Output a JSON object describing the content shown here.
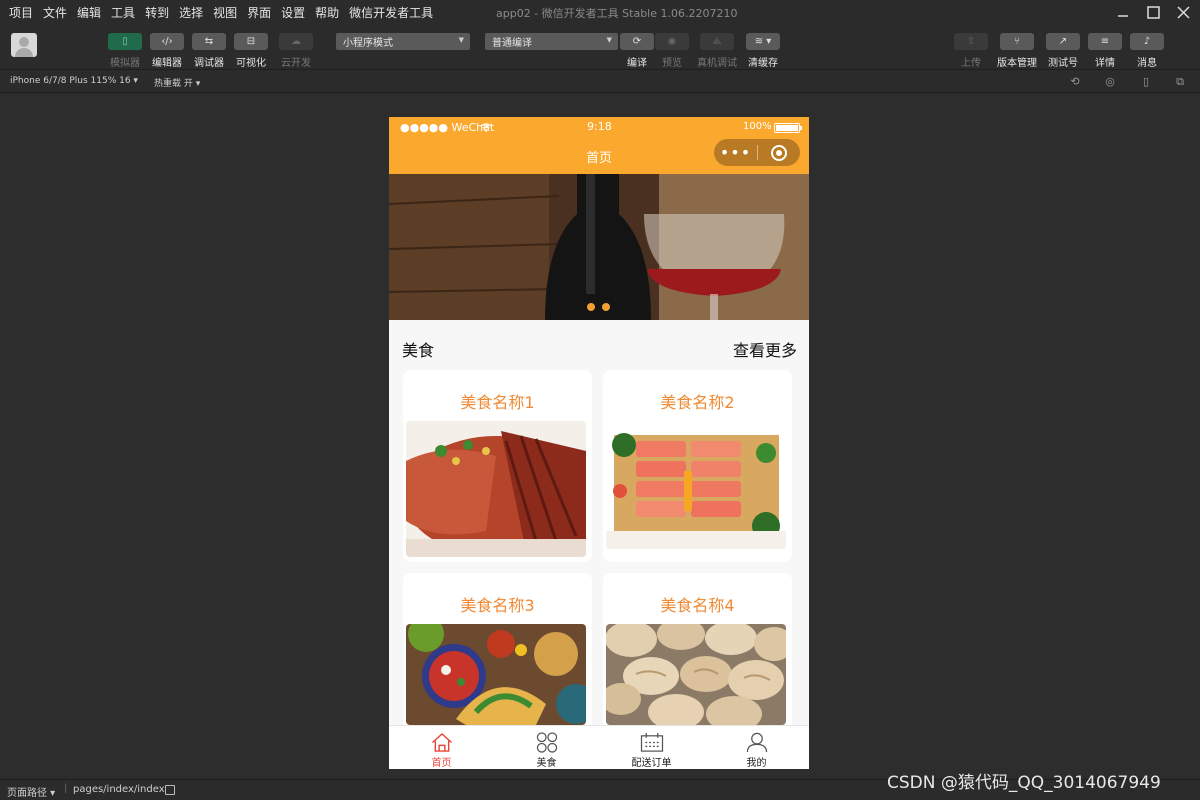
{
  "menubar": {
    "items": [
      "项目",
      "文件",
      "编辑",
      "工具",
      "转到",
      "选择",
      "视图",
      "界面",
      "设置",
      "帮助",
      "微信开发者工具"
    ],
    "window_title": "app02 - 微信开发者工具 Stable 1.06.2207210"
  },
  "toolbar": {
    "left_buttons": [
      {
        "label": "模拟器",
        "icon": "phone-icon",
        "state": "active"
      },
      {
        "label": "编辑器",
        "icon": "code-icon",
        "state": "normal"
      },
      {
        "label": "调试器",
        "icon": "debug-icon",
        "state": "normal"
      },
      {
        "label": "可视化",
        "icon": "layout-icon",
        "state": "normal"
      },
      {
        "label": "云开发",
        "icon": "cloud-icon",
        "state": "disabled"
      }
    ],
    "mode_select": "小程序模式",
    "compile_select": "普通编译",
    "center_buttons": [
      {
        "label": "编译",
        "icon": "refresh-icon",
        "state": "normal"
      },
      {
        "label": "预览",
        "icon": "eye-icon",
        "state": "disabled"
      },
      {
        "label": "真机调试",
        "icon": "device-debug-icon",
        "state": "disabled"
      },
      {
        "label": "清缓存",
        "icon": "layers-icon",
        "state": "normal"
      }
    ],
    "right_buttons": [
      {
        "label": "上传",
        "icon": "upload-icon",
        "state": "disabled"
      },
      {
        "label": "版本管理",
        "icon": "branch-icon",
        "state": "normal"
      },
      {
        "label": "测试号",
        "icon": "external-link-icon",
        "state": "normal"
      },
      {
        "label": "详情",
        "icon": "menu-icon",
        "state": "normal"
      },
      {
        "label": "消息",
        "icon": "bell-icon",
        "state": "normal"
      }
    ]
  },
  "subbar": {
    "device": "iPhone 6/7/8 Plus 115% 16 ▾",
    "hot_reload": "热重载 开 ▾"
  },
  "phone": {
    "status": {
      "carrier": "●●●●● WeChat",
      "time": "9:18",
      "battery": "100%"
    },
    "nav_title": "首页",
    "capsule_more": "•••",
    "banner_dots": 2,
    "section_title": "美食",
    "section_more": "查看更多",
    "cards": [
      {
        "name": "美食名称1"
      },
      {
        "name": "美食名称2"
      },
      {
        "name": "美食名称3"
      },
      {
        "name": "美食名称4"
      }
    ],
    "tabs": [
      {
        "label": "首页",
        "icon": "home-icon",
        "active": true
      },
      {
        "label": "美食",
        "icon": "grid-icon",
        "active": false
      },
      {
        "label": "配送订单",
        "icon": "calendar-icon",
        "active": false
      },
      {
        "label": "我的",
        "icon": "user-icon",
        "active": false
      }
    ]
  },
  "bottombar": {
    "path_label": "页面路径 ▾",
    "path": "pages/index/index"
  },
  "watermark": "CSDN @猿代码_QQ_3014067949",
  "colors": {
    "nav_orange": "#fba92e",
    "card_title_orange": "#f08a34",
    "active_tab_red": "#e5483a",
    "ide_bg": "#2b2b2b"
  }
}
